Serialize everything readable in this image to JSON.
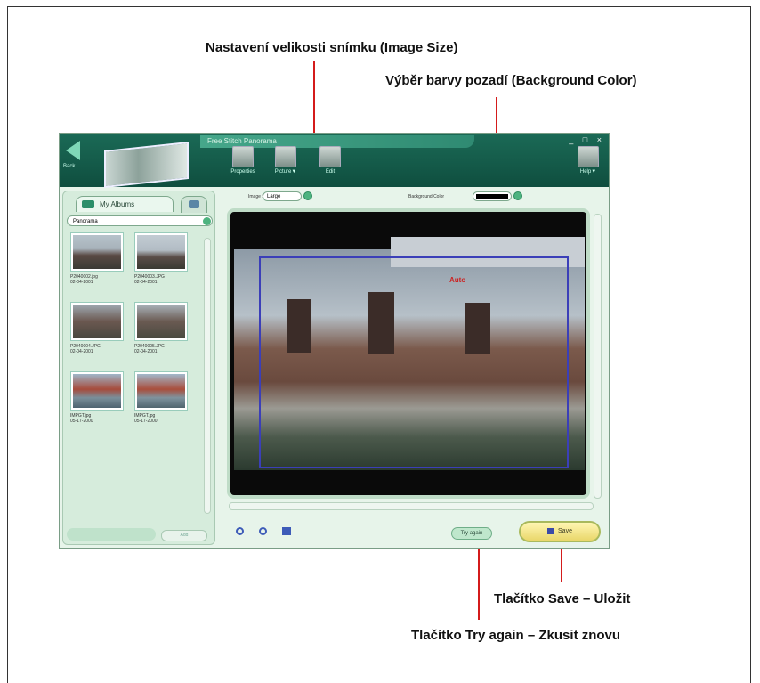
{
  "callouts": {
    "image_size": "Nastavení velikosti snímku (Image Size)",
    "background_color": "Výběr barvy pozadí (Background Color)",
    "save": "Tlačítko Save – Uložit",
    "try_again": "Tlačítko Try again – Zkusit znovu"
  },
  "app": {
    "title": "Free Stitch Panorama",
    "back_label": "Back",
    "toolbar": {
      "properties": "Properties",
      "picture": "Picture▼",
      "edit": "Edit",
      "help": "Help▼"
    },
    "window_controls": "_ □ ×"
  },
  "left": {
    "tab_label": "My Albums",
    "album": "Panorama",
    "thumbs": [
      {
        "name": "P2040002.jpg",
        "date": "02-04-2001"
      },
      {
        "name": "P2040003.JPG",
        "date": "02-04-2001"
      },
      {
        "name": "P2040004.JPG",
        "date": "02-04-2001"
      },
      {
        "name": "P2040005.JPG",
        "date": "02-04-2001"
      },
      {
        "name": "IMPGT.jpg",
        "date": "05-17-2000"
      },
      {
        "name": "IMPGT.jpg",
        "date": "05-17-2000"
      }
    ],
    "add_label": "Add"
  },
  "settings": {
    "image_size_label": "Image Size",
    "image_size_value": "Large",
    "bg_label": "Background Color",
    "bg_color": "#000000"
  },
  "preview": {
    "crop_label": "Auto"
  },
  "buttons": {
    "try_again": "Try again",
    "save": "Save"
  }
}
